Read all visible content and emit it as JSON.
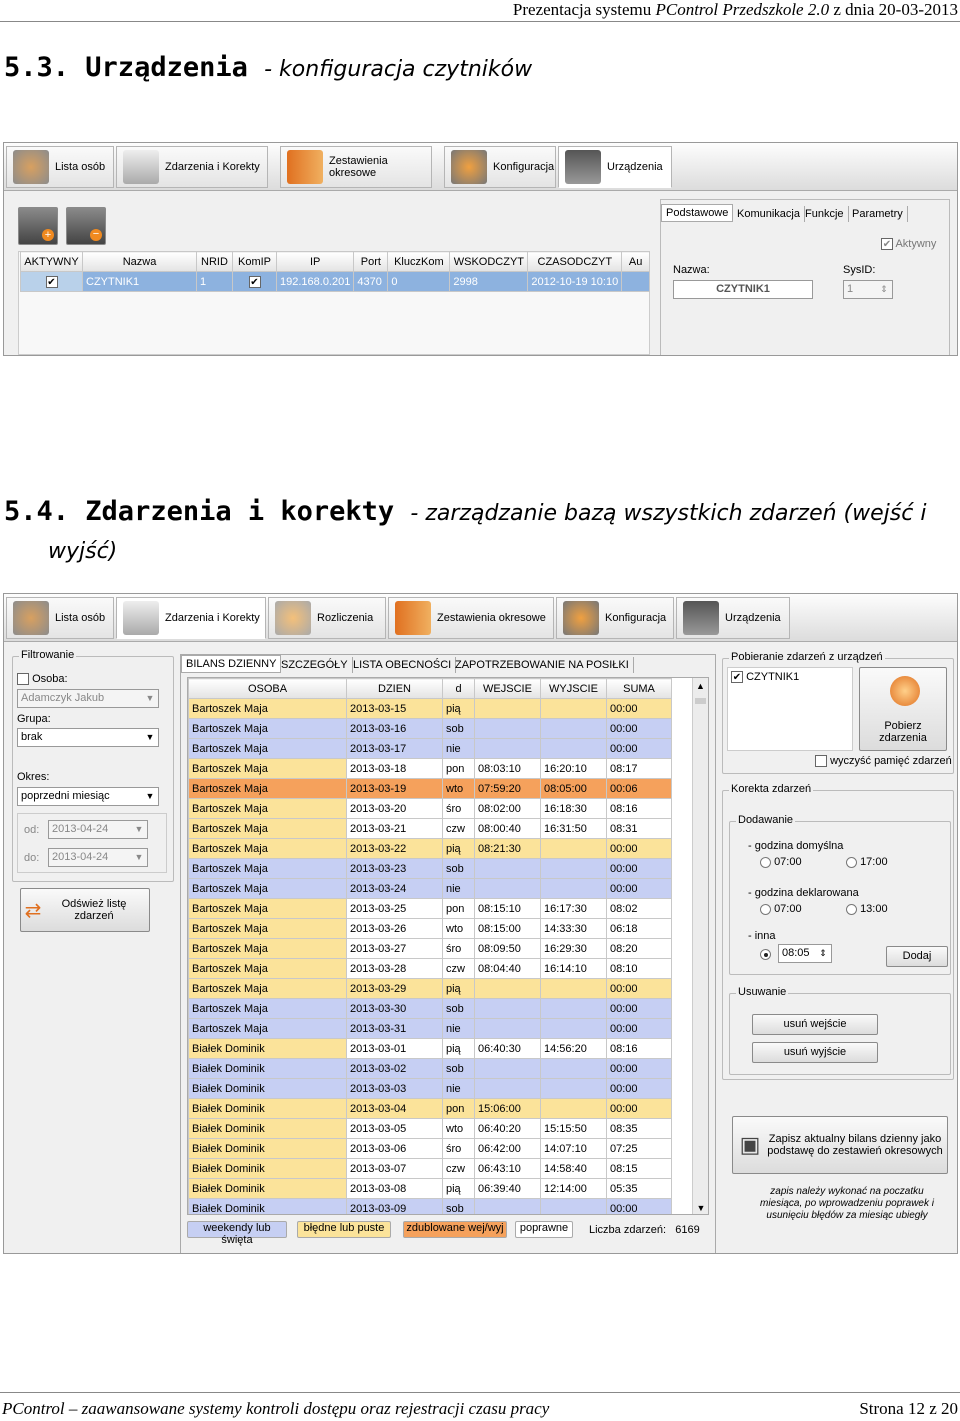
{
  "header": {
    "prefix": "Prezentacja systemu",
    "product": "PControl Przedszkole 2.0",
    "date": "z dnia 20-03-2013"
  },
  "section1": {
    "number": "5.3.",
    "title": "Urządzenia",
    "subtitle": "- konfiguracja czytników"
  },
  "section2": {
    "number": "5.4.",
    "title": "Zdarzenia i korekty",
    "subtitle": "- zarządzanie bazą wszystkich zdarzeń (wejść i",
    "subtitle2": "wyjść)"
  },
  "shot1": {
    "tabs": [
      "Lista osób",
      "Zdarzenia i Korekty",
      "Zestawienia okresowe",
      "Konfiguracja",
      "Urządzenia"
    ],
    "columns": [
      "AKTYWNY",
      "Nazwa",
      "NRID",
      "KomIP",
      "IP",
      "Port",
      "KluczKom",
      "WSKODCZYT",
      "CZASODCZYT",
      "Au"
    ],
    "row": {
      "aktywny": "✔",
      "nazwa": "CZYTNIK1",
      "nrid": "1",
      "komip": "✔",
      "ip": "192.168.0.201",
      "port": "4370",
      "klucz": "0",
      "wsk": "2998",
      "czas": "2012-10-19 10:10"
    },
    "subtabs": [
      "Podstawowe",
      "Komunikacja",
      "Funkcje",
      "Parametry"
    ],
    "aktywny_label": "Aktywny",
    "nazwa_label": "Nazwa:",
    "nazwa_value": "CZYTNIK1",
    "sysid_label": "SysID:",
    "sysid_value": "1"
  },
  "shot2": {
    "tabs": [
      "Lista osób",
      "Zdarzenia i Korekty",
      "Rozliczenia",
      "Zestawienia okresowe",
      "Konfiguracja",
      "Urządzenia"
    ],
    "filter": {
      "legend": "Filtrowanie",
      "osoba_label": "Osoba:",
      "osoba_value": "Adamczyk Jakub",
      "grupa_label": "Grupa:",
      "grupa_value": "brak",
      "okres_label": "Okres:",
      "okres_value": "poprzedni miesiąc",
      "od_label": "od:",
      "od_value": "2013-04-24",
      "do_label": "do:",
      "do_value": "2013-04-24",
      "refresh": "Odśwież listę zdarzeń"
    },
    "subtabs": [
      "BILANS DZIENNY",
      "SZCZEGÓŁY",
      "LISTA OBECNOŚCI",
      "ZAPOTRZEBOWANIE NA POSIŁKI"
    ],
    "columns": [
      "OSOBA",
      "DZIEN",
      "d",
      "WEJSCIE",
      "WYJSCIE",
      "SUMA"
    ],
    "rows": [
      [
        "Bartoszek Maja",
        "2013-03-15",
        "pią",
        "",
        "",
        "00:00",
        "y"
      ],
      [
        "Bartoszek Maja",
        "2013-03-16",
        "sob",
        "",
        "",
        "00:00",
        "b"
      ],
      [
        "Bartoszek Maja",
        "2013-03-17",
        "nie",
        "",
        "",
        "00:00",
        "b"
      ],
      [
        "Bartoszek Maja",
        "2013-03-18",
        "pon",
        "08:03:10",
        "16:20:10",
        "08:17",
        "w"
      ],
      [
        "Bartoszek Maja",
        "2013-03-19",
        "wto",
        "07:59:20",
        "08:05:00",
        "00:06",
        "o"
      ],
      [
        "Bartoszek Maja",
        "2013-03-20",
        "śro",
        "08:02:00",
        "16:18:30",
        "08:16",
        "w"
      ],
      [
        "Bartoszek Maja",
        "2013-03-21",
        "czw",
        "08:00:40",
        "16:31:50",
        "08:31",
        "w"
      ],
      [
        "Bartoszek Maja",
        "2013-03-22",
        "pią",
        "08:21:30",
        "",
        "00:00",
        "y"
      ],
      [
        "Bartoszek Maja",
        "2013-03-23",
        "sob",
        "",
        "",
        "00:00",
        "b"
      ],
      [
        "Bartoszek Maja",
        "2013-03-24",
        "nie",
        "",
        "",
        "00:00",
        "b"
      ],
      [
        "Bartoszek Maja",
        "2013-03-25",
        "pon",
        "08:15:10",
        "16:17:30",
        "08:02",
        "w"
      ],
      [
        "Bartoszek Maja",
        "2013-03-26",
        "wto",
        "08:15:00",
        "14:33:30",
        "06:18",
        "w"
      ],
      [
        "Bartoszek Maja",
        "2013-03-27",
        "śro",
        "08:09:50",
        "16:29:30",
        "08:20",
        "w"
      ],
      [
        "Bartoszek Maja",
        "2013-03-28",
        "czw",
        "08:04:40",
        "16:14:10",
        "08:10",
        "w"
      ],
      [
        "Bartoszek Maja",
        "2013-03-29",
        "pią",
        "",
        "",
        "00:00",
        "y"
      ],
      [
        "Bartoszek Maja",
        "2013-03-30",
        "sob",
        "",
        "",
        "00:00",
        "b"
      ],
      [
        "Bartoszek Maja",
        "2013-03-31",
        "nie",
        "",
        "",
        "00:00",
        "b"
      ],
      [
        "Białek Dominik",
        "2013-03-01",
        "pią",
        "06:40:30",
        "14:56:20",
        "08:16",
        "w"
      ],
      [
        "Białek Dominik",
        "2013-03-02",
        "sob",
        "",
        "",
        "00:00",
        "b"
      ],
      [
        "Białek Dominik",
        "2013-03-03",
        "nie",
        "",
        "",
        "00:00",
        "b"
      ],
      [
        "Białek Dominik",
        "2013-03-04",
        "pon",
        "15:06:00",
        "",
        "00:00",
        "y"
      ],
      [
        "Białek Dominik",
        "2013-03-05",
        "wto",
        "06:40:20",
        "15:15:50",
        "08:35",
        "w"
      ],
      [
        "Białek Dominik",
        "2013-03-06",
        "śro",
        "06:42:00",
        "14:07:10",
        "07:25",
        "w"
      ],
      [
        "Białek Dominik",
        "2013-03-07",
        "czw",
        "06:43:10",
        "14:58:40",
        "08:15",
        "w"
      ],
      [
        "Białek Dominik",
        "2013-03-08",
        "pią",
        "06:39:40",
        "12:14:00",
        "05:35",
        "w"
      ],
      [
        "Białek Dominik",
        "2013-03-09",
        "sob",
        "",
        "",
        "00:00",
        "b"
      ]
    ],
    "legend": [
      "weekendy lub święta",
      "błędne lub puste",
      "zdublowane wej/wyj",
      "poprawne"
    ],
    "count_label": "Liczba zdarzeń:",
    "count_value": "6169",
    "pobieranie": {
      "legend": "Pobieranie zdarzeń z urządzeń",
      "device": "CZYTNIK1",
      "button": "Pobierz zdarzenia",
      "clear": "wyczyść pamięć zdarzeń"
    },
    "korekta": {
      "legend": "Korekta zdarzeń",
      "dodawanie": "Dodawanie",
      "def_label": "- godzina domyślna",
      "def1": "07:00",
      "def2": "17:00",
      "dekl_label": "- godzina deklarowana",
      "dekl1": "07:00",
      "dekl2": "13:00",
      "inna_label": "- inna",
      "inna_value": "08:05",
      "dodaj": "Dodaj",
      "usuwanie": "Usuwanie",
      "usun_wej": "usuń wejście",
      "usun_wyj": "usuń wyjście"
    },
    "zapisz": "Zapisz aktualny bilans dzienny jako podstawę do zestawień okresowych",
    "note": "zapis należy wykonać na poczatku miesiąca, po wprowadzeniu poprawek i usunięciu błędów za miesiąc ubiegły"
  },
  "footer": {
    "left": "PControl – zaawansowane systemy kontroli dostępu oraz rejestracji czasu pracy",
    "right": "Strona 12 z 20"
  },
  "colors": {
    "selected_row": "#b9d1ea",
    "weekend": "#c6cff3",
    "error": "#fbe39a",
    "duplicate": "#f5a15c",
    "ok": "#ffffff"
  }
}
